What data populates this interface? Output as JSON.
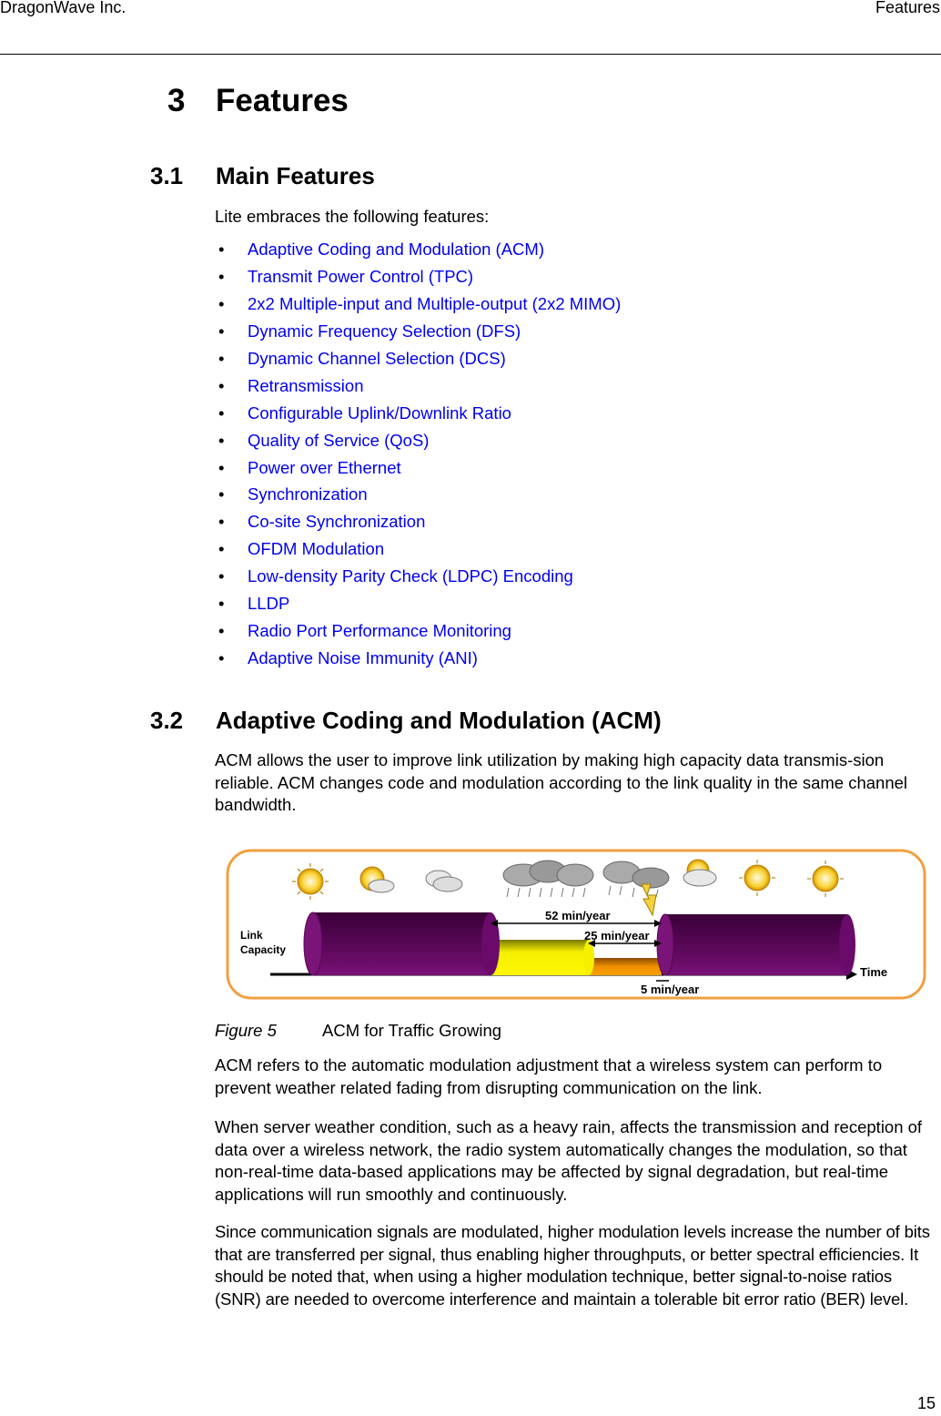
{
  "header": {
    "company": "DragonWave Inc.",
    "section": "Features"
  },
  "chapter": {
    "number": "3",
    "title": "Features"
  },
  "section_3_1": {
    "number": "3.1",
    "title": "Main Features",
    "intro": "Lite embraces the following features:",
    "features": [
      "Adaptive Coding and Modulation (ACM)",
      "Transmit Power Control (TPC)",
      "2x2 Multiple-input and Multiple-output (2x2 MIMO)",
      "Dynamic Frequency Selection (DFS)",
      "Dynamic Channel Selection (DCS)",
      "Retransmission",
      "Configurable Uplink/Downlink Ratio",
      "Quality of Service (QoS)",
      "Power over Ethernet",
      "Synchronization",
      "Co-site Synchronization",
      "OFDM Modulation",
      "Low-density Parity Check (LDPC) Encoding",
      "LLDP",
      "Radio Port Performance Monitoring",
      "Adaptive Noise Immunity (ANI)"
    ],
    "bullet": "•"
  },
  "section_3_2": {
    "number": "3.2",
    "title": "Adaptive Coding and Modulation (ACM)",
    "para1": "ACM allows the user to improve link utilization by making high capacity data transmis-sion reliable. ACM changes code and modulation according to the link quality in the same channel bandwidth.",
    "figure": {
      "label": "Figure 5",
      "caption": "ACM for Traffic Growing",
      "y_label_line1": "Link",
      "y_label_line2": "Capacity",
      "x_label": "Time",
      "annot_52": "52 min/year",
      "annot_25": "25 min/year",
      "annot_5": "5 min/year",
      "weather_icons": [
        "sun-icon",
        "sun-cloud-icon",
        "cloud-icon",
        "rain-cloud-icon",
        "rain-cloud-icon",
        "storm-cloud-icon",
        "storm-cloud-icon",
        "sun-cloud-icon",
        "sun-icon",
        "sun-icon"
      ],
      "colors": {
        "frame": "#f0a040",
        "high": "#6a0a6a",
        "mid": "#f5f000",
        "low": "#f29a00"
      }
    },
    "para2": "ACM refers to the automatic modulation adjustment that a wireless system can perform to prevent weather related fading from disrupting communication on the link.",
    "para3": "When server weather condition, such as a heavy rain, affects the transmission and reception of data over a wireless network, the radio system automatically changes the modulation, so that non-real-time data-based applications may be affected by signal degradation, but real-time applications will run smoothly and continuously.",
    "para4": "Since communication signals are modulated, higher modulation levels increase the number of bits that are transferred per signal, thus enabling higher throughputs, or better spectral efficiencies. It should be noted that, when using a higher modulation technique, better signal-to-noise ratios (SNR) are needed to overcome interference and maintain a tolerable bit error ratio (BER) level."
  },
  "page_number": "15"
}
